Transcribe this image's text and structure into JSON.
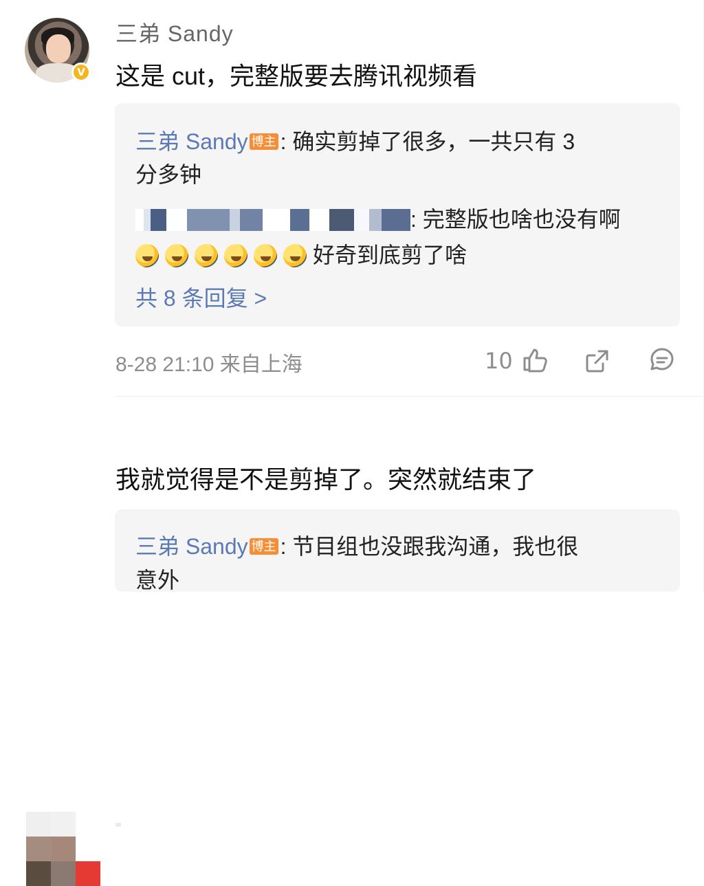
{
  "comment1": {
    "author": "三弟 Sandy",
    "badge": "V",
    "text": "这是 cut，完整版要去腾讯视频看",
    "replies": [
      {
        "author": "三弟 Sandy",
        "tag": "博主",
        "line1": ": 确实剪掉了很多，一共只有 3",
        "line2": "分多钟"
      },
      {
        "author_blurred": true,
        "line1": ": 完整版也啥也没有啊",
        "emoji_count": 6,
        "line2": "好奇到底剪了啥"
      }
    ],
    "more_replies": "共 8 条回复 >",
    "meta": "8-28 21:10   来自上海",
    "like_count": "10"
  },
  "comment2": {
    "text": "我就觉得是不是剪掉了。突然就结束了",
    "reply": {
      "author": "三弟 Sandy",
      "tag": "博主",
      "line1": ": 节目组也没跟我沟通，我也很",
      "line2": "意外"
    }
  },
  "icons": {
    "like": "thumbs-up-icon",
    "share": "share-icon",
    "comment": "comment-icon",
    "emoji": "laughing-tears-emoji"
  },
  "colors": {
    "link": "#5b7ab5",
    "tag": "#f58e35",
    "badge": "#f5b51f",
    "meta": "#8d8d8d",
    "reply_bg": "#f5f5f5"
  }
}
